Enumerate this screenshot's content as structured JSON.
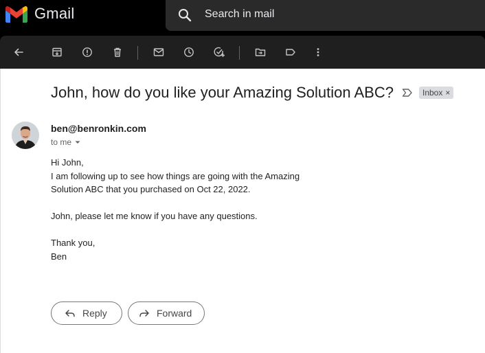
{
  "app": {
    "name": "Gmail"
  },
  "search": {
    "placeholder": "Search in mail"
  },
  "toolbar": {
    "icons": [
      "back-arrow-icon",
      "archive-icon",
      "report-spam-icon",
      "delete-icon",
      "mark-unread-icon",
      "snooze-icon",
      "add-to-tasks-icon",
      "move-to-icon",
      "label-icon",
      "more-icon"
    ]
  },
  "email": {
    "subject": "John, how do you like your Amazing Solution ABC?",
    "label": "Inbox",
    "label_close": "×",
    "sender": "ben@benronkin.com",
    "recipient": "to me",
    "body": [
      "Hi John,",
      "I am following up to see how things are going with the Amazing",
      "Solution ABC that you purchased on Oct 22, 2022.",
      "",
      "John, please let me know if you have any questions.",
      "",
      "Thank you,",
      "Ben"
    ]
  },
  "actions": {
    "reply": "Reply",
    "forward": "Forward"
  },
  "colors": {
    "gmail_red": "#ea4335",
    "gmail_blue": "#4285f4",
    "gmail_green": "#34a853",
    "gmail_yellow": "#fbbc04"
  }
}
